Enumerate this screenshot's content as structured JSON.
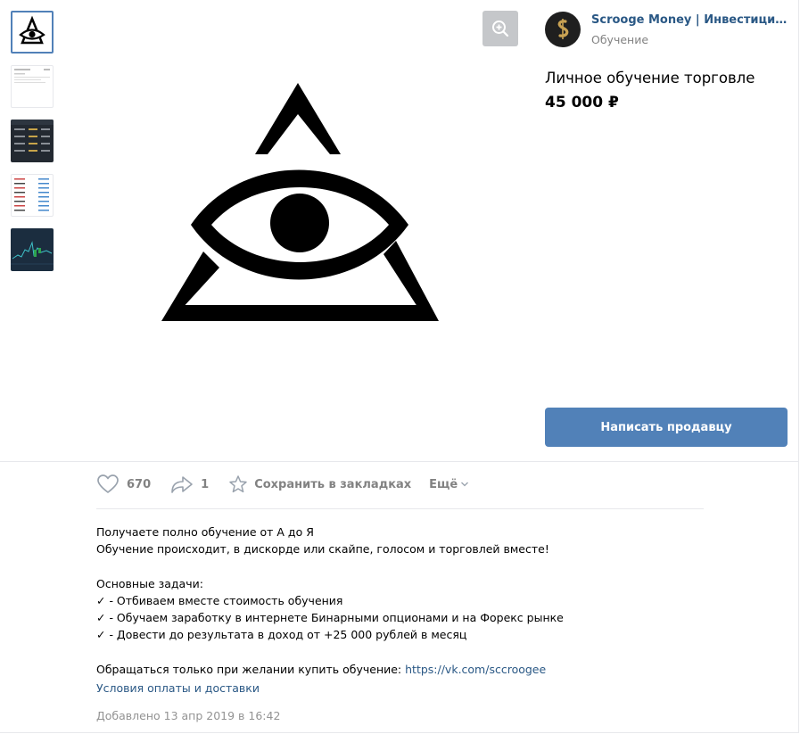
{
  "seller": {
    "name": "Scrooge Money | Инвестиции и …",
    "category": "Обучение"
  },
  "product": {
    "title": "Личное обучение торговле",
    "price": "45 000 ₽"
  },
  "contact_button": "Написать продавцу",
  "actions": {
    "likes": "670",
    "shares": "1",
    "bookmark": "Сохранить в закладках",
    "more": "Ещё"
  },
  "description": {
    "line1": "Получаете полно обучение от А до Я",
    "line2": "Обучение происходит, в дискорде или скайпе, голосом и торговлей вместе!",
    "line3": "",
    "line4": "Основные задачи:",
    "line5": "✓ - Отбиваем вместе стоимость обучения",
    "line6": "✓ - Обучаем заработку в интернете Бинарными опционами и на Форекс рынке",
    "line7": "✓ - Довести до результата в доход от +25 000 рублей в месяц",
    "line8": "",
    "contact_text": "Обращаться только при желании купить обучение: ",
    "contact_link": "https://vk.com/sccroogee"
  },
  "terms_link": "Условия оплаты и доставки",
  "added": "Добавлено 13 апр 2019 в 16:42",
  "colors": {
    "accent": "#5181b8",
    "link": "#2a5885",
    "muted": "#828282"
  }
}
